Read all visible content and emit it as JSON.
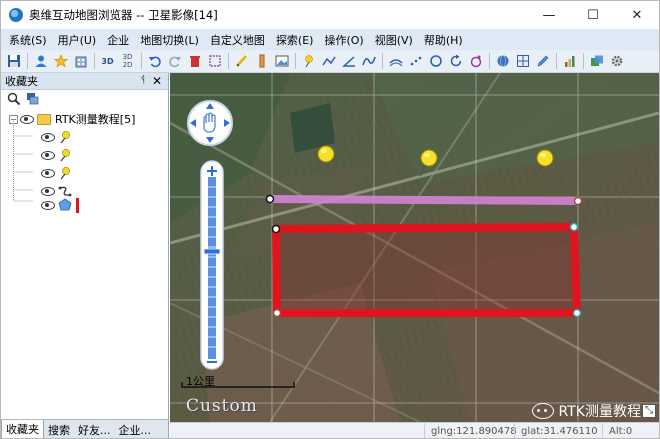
{
  "window": {
    "title": "奥维互动地图浏览器 -- 卫星影像[14]",
    "controls": {
      "minimize": "—",
      "maximize": "☐",
      "close": "✕"
    }
  },
  "menu": [
    "系统(S)",
    "用户(U)",
    "企业",
    "地图切换(L)",
    "自定义地图",
    "探索(E)",
    "操作(O)",
    "视图(V)",
    "帮助(H)"
  ],
  "toolbar": {
    "icons": [
      "save-icon",
      "user-icon",
      "star-icon",
      "building-icon",
      "3d-icon",
      "2d-3d-icon",
      "undo-icon",
      "redo-icon",
      "delete-icon",
      "select-box-icon",
      "pen-icon",
      "ruler-icon",
      "image-icon",
      "pin-icon",
      "line-icon",
      "angle-icon",
      "curve-icon",
      "road-icon",
      "dots-icon",
      "polygon-icon",
      "rotate-icon",
      "circle-tool-icon",
      "sphere-icon",
      "grid-icon",
      "edit-icon",
      "chart-icon",
      "layers-icon",
      "gear-icon"
    ],
    "labels": {
      "3d": "3D",
      "3d2d_top": "3D",
      "3d2d_bottom": "2D"
    }
  },
  "sidebar": {
    "title": "收藏夹",
    "pin": "ᛩ",
    "close": "✕",
    "tree": {
      "root_label": "RTK测量教程[5]",
      "children": [
        "pin",
        "pin",
        "pin",
        "track",
        "polygon"
      ]
    },
    "tabs": [
      "收藏夹",
      "搜索",
      "好友...",
      "企业..."
    ]
  },
  "map": {
    "scale_label": "1公里",
    "custom_label": "Custom",
    "watermark": "RTK测量教程",
    "colors": {
      "line": "#d283d6",
      "polygon": "#e0141c",
      "pin": "#f5e12a"
    }
  },
  "status": {
    "glng": "glng:121.890478",
    "glat": "glat:31.476110",
    "alt": "Alt:0"
  }
}
